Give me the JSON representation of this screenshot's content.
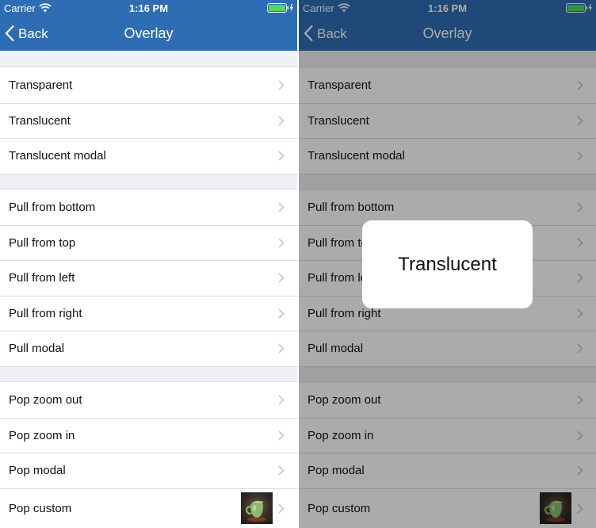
{
  "status_bar": {
    "carrier": "Carrier",
    "time": "1:16 PM",
    "wifi_icon": "wifi-icon",
    "battery_icon": "battery-charging-icon"
  },
  "nav": {
    "back_label": "Back",
    "title": "Overlay"
  },
  "sections": [
    {
      "rows": [
        {
          "label": "Transparent"
        },
        {
          "label": "Translucent"
        },
        {
          "label": "Translucent modal"
        }
      ]
    },
    {
      "rows": [
        {
          "label": "Pull from bottom"
        },
        {
          "label": "Pull from top"
        },
        {
          "label": "Pull from left"
        },
        {
          "label": "Pull from right"
        },
        {
          "label": "Pull modal"
        }
      ]
    },
    {
      "rows": [
        {
          "label": "Pop zoom out"
        },
        {
          "label": "Pop zoom in"
        },
        {
          "label": "Pop modal"
        },
        {
          "label": "Pop custom",
          "thumbnail": "jug-thumbnail"
        }
      ]
    }
  ],
  "overlay_popup": {
    "text": "Translucent"
  },
  "colors": {
    "nav_bar": "#2e6db4",
    "background": "#efeff4",
    "battery": "#4cd964",
    "overlay_dim": "rgba(0,0,0,0.33)"
  }
}
